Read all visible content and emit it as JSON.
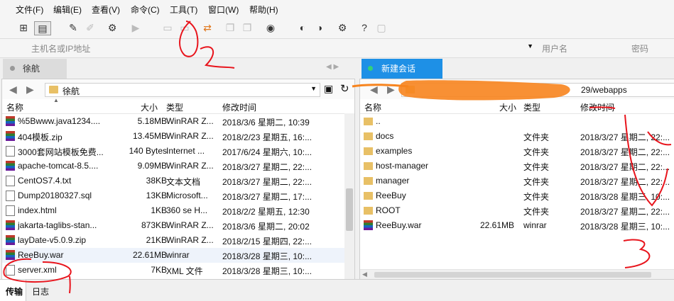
{
  "menu": [
    "文件(F)",
    "编辑(E)",
    "查看(V)",
    "命令(C)",
    "工具(T)",
    "窗口(W)",
    "帮助(H)"
  ],
  "address": {
    "host_placeholder": "主机名或IP地址",
    "user_placeholder": "用户名",
    "password_placeholder": "密码"
  },
  "tabs": {
    "left": "徐航",
    "right": "新建会话"
  },
  "left": {
    "path": "徐航",
    "columns": [
      "名称",
      "大小",
      "类型",
      "修改时间"
    ],
    "rows": [
      {
        "icon": "rar",
        "name": "%5Bwww.java1234....",
        "size": "5.18MB",
        "type": "WinRAR Z...",
        "date": "2018/3/6 星期二, 10:39"
      },
      {
        "icon": "rar",
        "name": "404模板.zip",
        "size": "13.45MB",
        "type": "WinRAR Z...",
        "date": "2018/2/23 星期五, 16:..."
      },
      {
        "icon": "url",
        "name": "3000套网站模板免费...",
        "size": "140 Bytes",
        "type": "Internet ...",
        "date": "2017/6/24 星期六, 10:..."
      },
      {
        "icon": "rar",
        "name": "apache-tomcat-8.5....",
        "size": "9.09MB",
        "type": "WinRAR Z...",
        "date": "2018/3/27 星期二, 22:..."
      },
      {
        "icon": "txt",
        "name": "CentOS7.4.txt",
        "size": "38KB",
        "type": "文本文档",
        "date": "2018/3/27 星期二, 22:..."
      },
      {
        "icon": "txt",
        "name": "Dump20180327.sql",
        "size": "13KB",
        "type": "Microsoft...",
        "date": "2018/3/27 星期二, 17:..."
      },
      {
        "icon": "htm",
        "name": "index.html",
        "size": "1KB",
        "type": "360 se H...",
        "date": "2018/2/2 星期五, 12:30"
      },
      {
        "icon": "rar",
        "name": "jakarta-taglibs-stan...",
        "size": "873KB",
        "type": "WinRAR Z...",
        "date": "2018/3/6 星期二, 20:02"
      },
      {
        "icon": "rar",
        "name": "layDate-v5.0.9.zip",
        "size": "21KB",
        "type": "WinRAR Z...",
        "date": "2018/2/15 星期四, 22:..."
      },
      {
        "icon": "rar",
        "name": "ReeBuy.war",
        "size": "22.61MB",
        "type": "winrar",
        "date": "2018/3/28 星期三, 10:..."
      },
      {
        "icon": "txt",
        "name": "server.xml",
        "size": "7KB",
        "type": "XML 文件",
        "date": "2018/3/28 星期三, 10:..."
      }
    ]
  },
  "right": {
    "path_suffix": "29/webapps",
    "columns": [
      "名称",
      "大小",
      "类型",
      "修改时间"
    ],
    "rows": [
      {
        "icon": "fold",
        "name": "..",
        "size": "",
        "type": "",
        "date": ""
      },
      {
        "icon": "fold",
        "name": "docs",
        "size": "",
        "type": "文件夹",
        "date": "2018/3/27 星期二, 22:..."
      },
      {
        "icon": "fold",
        "name": "examples",
        "size": "",
        "type": "文件夹",
        "date": "2018/3/27 星期二, 22:..."
      },
      {
        "icon": "fold",
        "name": "host-manager",
        "size": "",
        "type": "文件夹",
        "date": "2018/3/27 星期二, 22:..."
      },
      {
        "icon": "fold",
        "name": "manager",
        "size": "",
        "type": "文件夹",
        "date": "2018/3/27 星期二, 22:..."
      },
      {
        "icon": "fold",
        "name": "ReeBuy",
        "size": "",
        "type": "文件夹",
        "date": "2018/3/28 星期三, 10:..."
      },
      {
        "icon": "fold",
        "name": "ROOT",
        "size": "",
        "type": "文件夹",
        "date": "2018/3/27 星期二, 22:..."
      },
      {
        "icon": "rar",
        "name": "ReeBuy.war",
        "size": "22.61MB",
        "type": "winrar",
        "date": "2018/3/28 星期三, 10:..."
      }
    ]
  },
  "bottom": {
    "transfer_tab": "传输",
    "log_tab": "日志"
  },
  "colors": {
    "active_tab": "#1e90e6",
    "annotation_red": "#e8141c",
    "annotation_orange": "#f7841e"
  }
}
